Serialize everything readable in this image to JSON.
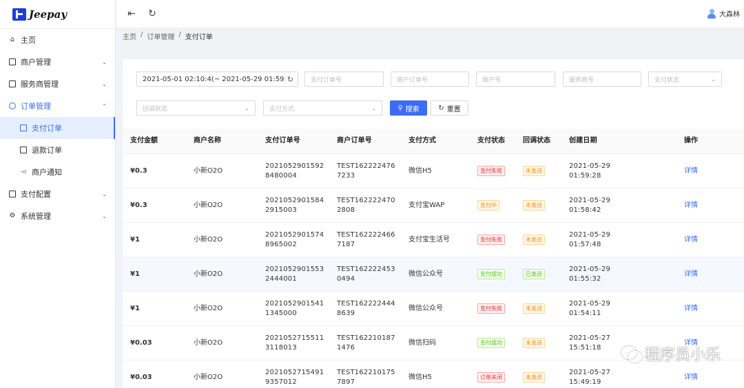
{
  "app": {
    "logo_text": "Jeepay"
  },
  "sidebar": {
    "items": [
      {
        "label": "主页",
        "icon": "home-icon"
      },
      {
        "label": "商户管理",
        "icon": "store-icon"
      },
      {
        "label": "服务商管理",
        "icon": "partner-icon"
      },
      {
        "label": "订单管理",
        "icon": "order-icon",
        "expanded": true
      },
      {
        "label": "支付配置",
        "icon": "config-icon"
      },
      {
        "label": "系统管理",
        "icon": "gear-icon"
      }
    ],
    "sub_items": [
      {
        "label": "支付订单",
        "icon": "pay-order-icon",
        "active": true
      },
      {
        "label": "退款订单",
        "icon": "refund-icon"
      },
      {
        "label": "商户通知",
        "icon": "notify-icon"
      }
    ]
  },
  "header": {
    "user_name": "大森林"
  },
  "breadcrumb": {
    "home": "主页",
    "sep": "/",
    "parent": "订单管理",
    "current": "支付订单"
  },
  "filters": {
    "date_range": "2021-05-01 02:10:4(~ 2021-05-29 01:59:5!",
    "pay_order_no": "支付订单号",
    "mch_order_no": "商户订单号",
    "mch_no": "商户号",
    "isv_no": "服务商号",
    "pay_state": "支付状态",
    "notify_state": "回调状态",
    "pay_way": "支付方式",
    "search_label": "搜索",
    "reset_label": "重置"
  },
  "table": {
    "headers": [
      "支付金额",
      "商户名称",
      "支付订单号",
      "商户订单号",
      "支付方式",
      "支付状态",
      "回调状态",
      "创建日期",
      "操作"
    ],
    "rows": [
      {
        "amount": "¥0.3",
        "mch_name": "小新O2O",
        "pay_no_1": "2021052901592",
        "pay_no_2": "8480004",
        "mch_no_1": "TEST162222476",
        "mch_no_2": "7233",
        "way": "微信H5",
        "state": "支付失败",
        "state_color": "red",
        "notify": "未发送",
        "notify_color": "orange",
        "date_1": "2021-05-29",
        "date_2": "01:59:28",
        "op": "详情"
      },
      {
        "amount": "¥0.3",
        "mch_name": "小新O2O",
        "pay_no_1": "2021052901584",
        "pay_no_2": "2915003",
        "mch_no_1": "TEST162222470",
        "mch_no_2": "2808",
        "way": "支付宝WAP",
        "state": "支付中",
        "state_color": "orange",
        "notify": "未发送",
        "notify_color": "orange",
        "date_1": "2021-05-29",
        "date_2": "01:58:42",
        "op": "详情"
      },
      {
        "amount": "¥1",
        "mch_name": "小新O2O",
        "pay_no_1": "2021052901574",
        "pay_no_2": "8965002",
        "mch_no_1": "TEST162222466",
        "mch_no_2": "7187",
        "way": "支付宝生活号",
        "state": "支付失败",
        "state_color": "red",
        "notify": "未发送",
        "notify_color": "orange",
        "date_1": "2021-05-29",
        "date_2": "01:57:48",
        "op": "详情"
      },
      {
        "amount": "¥1",
        "mch_name": "小新O2O",
        "pay_no_1": "2021052901553",
        "pay_no_2": "2444001",
        "mch_no_1": "TEST162222453",
        "mch_no_2": "0494",
        "way": "微信公众号",
        "state": "支付成功",
        "state_color": "green",
        "notify": "已发送",
        "notify_color": "green",
        "date_1": "2021-05-29",
        "date_2": "01:55:32",
        "op": "详情"
      },
      {
        "amount": "¥1",
        "mch_name": "小新O2O",
        "pay_no_1": "2021052901541",
        "pay_no_2": "1345000",
        "mch_no_1": "TEST162222444",
        "mch_no_2": "8639",
        "way": "微信公众号",
        "state": "支付失败",
        "state_color": "red",
        "notify": "未发送",
        "notify_color": "orange",
        "date_1": "2021-05-29",
        "date_2": "01:54:11",
        "op": "详情"
      },
      {
        "amount": "¥0.03",
        "mch_name": "小新O2O",
        "pay_no_1": "2021052715511",
        "pay_no_2": "3118013",
        "mch_no_1": "TEST162210187",
        "mch_no_2": "1476",
        "way": "微信扫码",
        "state": "支付成功",
        "state_color": "green",
        "notify": "未发送",
        "notify_color": "orange",
        "date_1": "2021-05-27",
        "date_2": "15:51:18",
        "op": "详情"
      },
      {
        "amount": "¥0.03",
        "mch_name": "小新O2O",
        "pay_no_1": "2021052715491",
        "pay_no_2": "9357012",
        "mch_no_1": "TEST162210175",
        "mch_no_2": "7897",
        "way": "微信H5",
        "state": "订单关闭",
        "state_color": "red",
        "notify": "未发送",
        "notify_color": "orange",
        "date_1": "2021-05-27",
        "date_2": "15:49:19",
        "op": "详情"
      }
    ]
  },
  "watermark": {
    "text": "程序员小乐"
  }
}
